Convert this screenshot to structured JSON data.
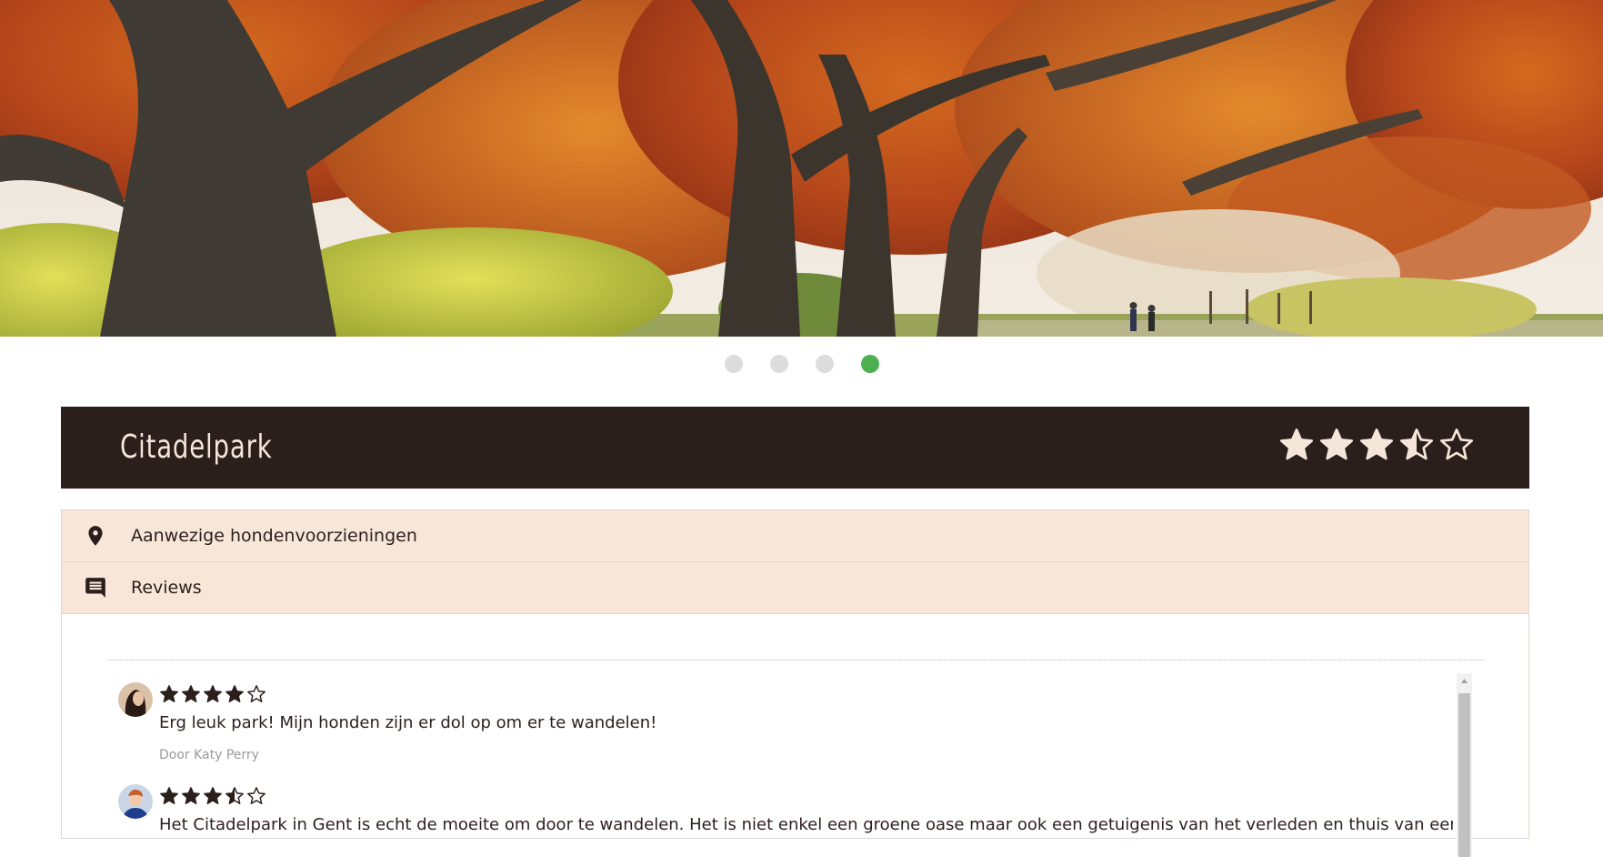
{
  "hero": {
    "alt": "Citadelpark in de herfst",
    "slides": 4,
    "active_slide": 4
  },
  "park": {
    "title": "Citadelpark",
    "rating": 3.5,
    "rating_max": 5
  },
  "accordion": [
    {
      "label": "Aanwezige hondenvoorzieningen",
      "icon": "location-pin-icon"
    },
    {
      "label": "Reviews",
      "icon": "comment-icon"
    }
  ],
  "reviews": [
    {
      "rating": 4,
      "text": "Erg leuk park! Mijn honden zijn er dol op om er te wandelen!",
      "author": "Door Katy Perry"
    },
    {
      "rating": 3.5,
      "text": "Het Citadelpark in Gent is echt de moeite om door te wandelen. Het is niet enkel een groene oase maar ook een getuigenis van het verleden en thuis van een aantal",
      "author": ""
    }
  ],
  "colors": {
    "dark": "#2b1f1c",
    "cream": "#f6e6da",
    "accordion_bg": "#f8e6d8",
    "dot_active": "#4caf50",
    "dot_inactive": "#dcdcdc"
  }
}
